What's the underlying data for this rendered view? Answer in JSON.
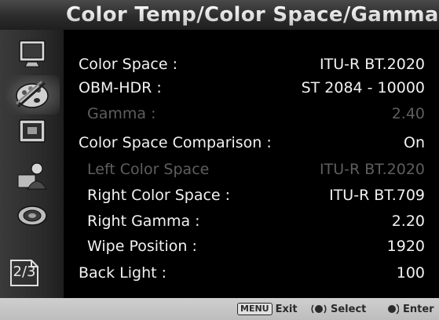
{
  "title": "Color Temp/Color Space/Gamma",
  "sidebar": {
    "icons": [
      "monitor-icon",
      "palette-icon",
      "picture-icon",
      "user-icon",
      "gear-icon"
    ],
    "active_index": 1,
    "page_indicator": "2/3"
  },
  "menu": {
    "items": [
      {
        "label": "Color Space :",
        "value": "ITU-R BT.2020",
        "enabled": true,
        "indent": false
      },
      {
        "label": "OBM-HDR :",
        "value": "ST 2084 - 10000",
        "enabled": true,
        "indent": false
      },
      {
        "label": "Gamma :",
        "value": "2.40",
        "enabled": false,
        "indent": true
      },
      {
        "label": "Color Space Comparison :",
        "value": "On",
        "enabled": true,
        "indent": false
      },
      {
        "label": "Left Color Space",
        "value": "ITU-R BT.2020",
        "enabled": false,
        "indent": true
      },
      {
        "label": "Right Color Space :",
        "value": "ITU-R BT.709",
        "enabled": true,
        "indent": true
      },
      {
        "label": "Right Gamma :",
        "value": "2.20",
        "enabled": true,
        "indent": true
      },
      {
        "label": "Wipe Position :",
        "value": "1920",
        "enabled": true,
        "indent": true
      },
      {
        "label": "Back Light :",
        "value": "100",
        "enabled": true,
        "indent": false
      }
    ]
  },
  "footer": {
    "exit_key": "MENU",
    "exit_label": "Exit",
    "select_label": "Select",
    "enter_label": "Enter"
  },
  "colors": {
    "text_enabled": "#f2f2f2",
    "text_disabled": "#5e5e5e",
    "footer_bg": "#c6c6c6",
    "title_bar_bg": "#2c2c2c"
  }
}
